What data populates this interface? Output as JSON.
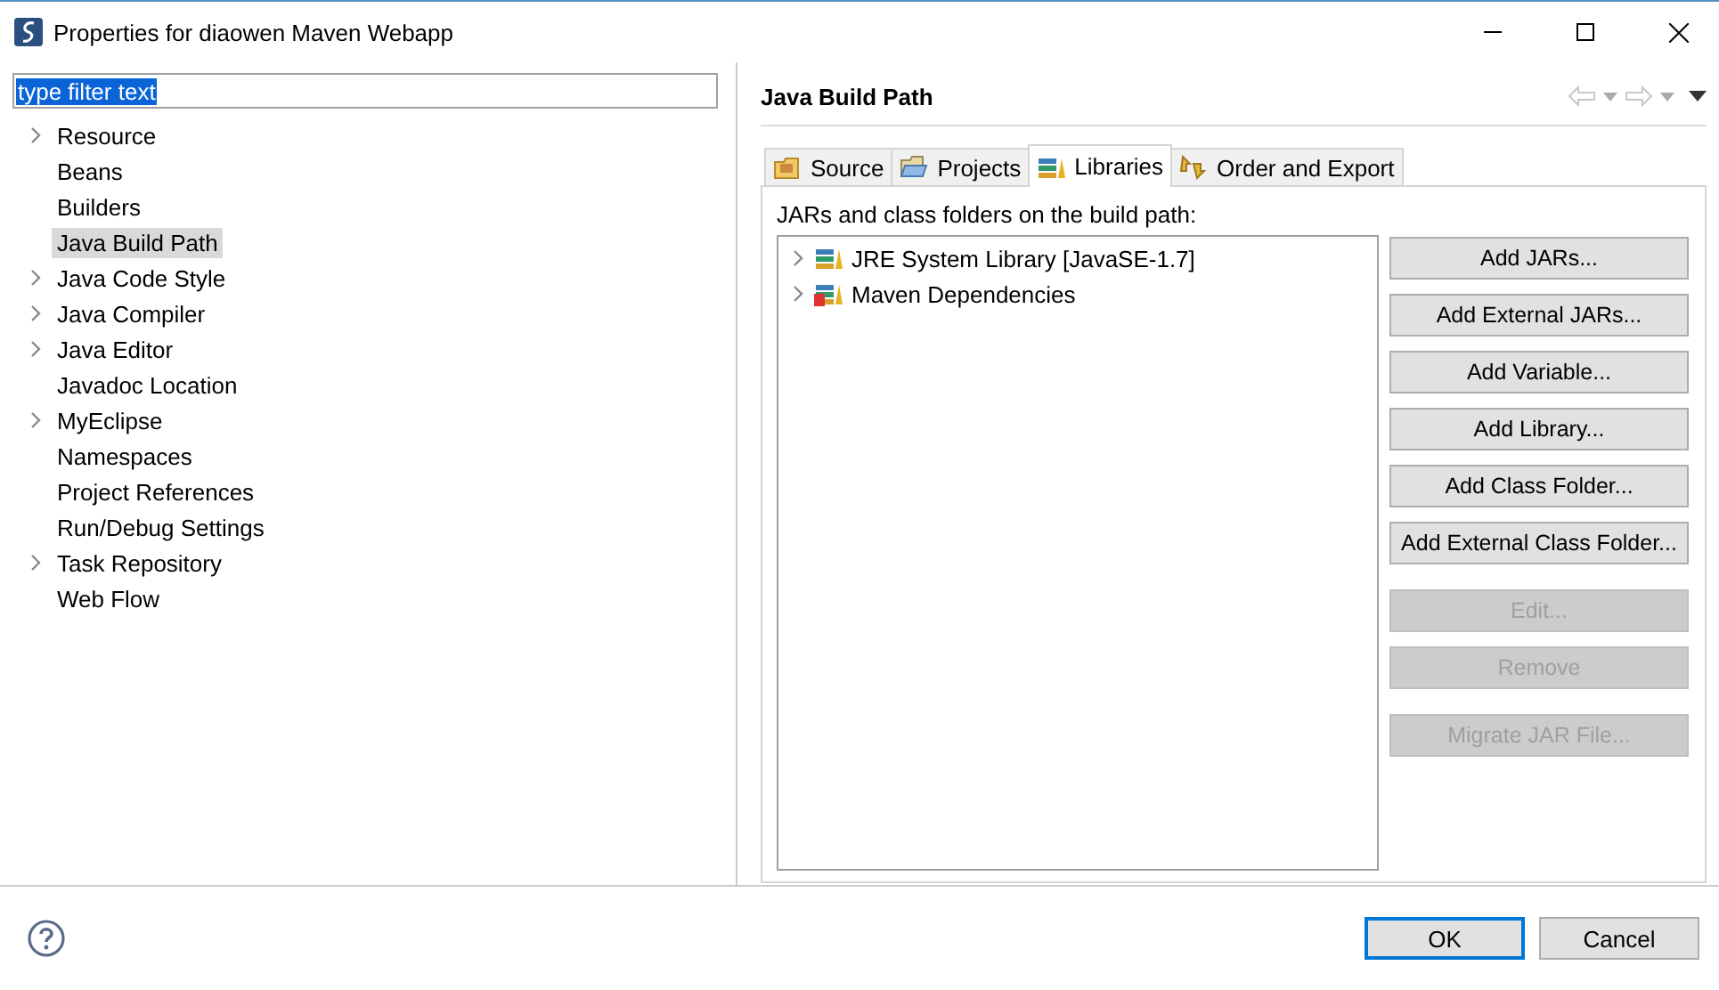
{
  "window": {
    "title": "Properties for diaowen Maven Webapp"
  },
  "filter": {
    "value": "type filter text",
    "selected": true
  },
  "sidebar": {
    "items": [
      {
        "label": "Resource",
        "expandable": true,
        "selected": false
      },
      {
        "label": "Beans",
        "expandable": false,
        "selected": false
      },
      {
        "label": "Builders",
        "expandable": false,
        "selected": false
      },
      {
        "label": "Java Build Path",
        "expandable": false,
        "selected": true
      },
      {
        "label": "Java Code Style",
        "expandable": true,
        "selected": false
      },
      {
        "label": "Java Compiler",
        "expandable": true,
        "selected": false
      },
      {
        "label": "Java Editor",
        "expandable": true,
        "selected": false
      },
      {
        "label": "Javadoc Location",
        "expandable": false,
        "selected": false
      },
      {
        "label": "MyEclipse",
        "expandable": true,
        "selected": false
      },
      {
        "label": "Namespaces",
        "expandable": false,
        "selected": false
      },
      {
        "label": "Project References",
        "expandable": false,
        "selected": false
      },
      {
        "label": "Run/Debug Settings",
        "expandable": false,
        "selected": false
      },
      {
        "label": "Task Repository",
        "expandable": true,
        "selected": false
      },
      {
        "label": "Web Flow",
        "expandable": false,
        "selected": false
      }
    ]
  },
  "page": {
    "title": "Java Build Path"
  },
  "tabs": [
    {
      "label": "Source",
      "kind": "source",
      "selected": false
    },
    {
      "label": "Projects",
      "kind": "projects",
      "selected": false
    },
    {
      "label": "Libraries",
      "kind": "libraries",
      "selected": true
    },
    {
      "label": "Order and Export",
      "kind": "order",
      "selected": false
    }
  ],
  "list_label": "JARs and class folders on the build path:",
  "entries": [
    {
      "label": "JRE System Library [JavaSE-1.7]",
      "kind": "jre",
      "expanded": false
    },
    {
      "label": "Maven Dependencies",
      "kind": "maven",
      "expanded": false
    }
  ],
  "button_groups": [
    [
      {
        "label": "Add JARs...",
        "disabled": false
      },
      {
        "label": "Add External JARs...",
        "disabled": false
      },
      {
        "label": "Add Variable...",
        "disabled": false
      },
      {
        "label": "Add Library...",
        "disabled": false
      },
      {
        "label": "Add Class Folder...",
        "disabled": false
      },
      {
        "label": "Add External Class Folder...",
        "disabled": false
      }
    ],
    [
      {
        "label": "Edit...",
        "disabled": true
      },
      {
        "label": "Remove",
        "disabled": true
      }
    ],
    [
      {
        "label": "Migrate JAR File...",
        "disabled": true
      }
    ]
  ],
  "dialog_buttons": [
    {
      "label": "OK",
      "default": true
    },
    {
      "label": "Cancel",
      "default": false
    }
  ]
}
